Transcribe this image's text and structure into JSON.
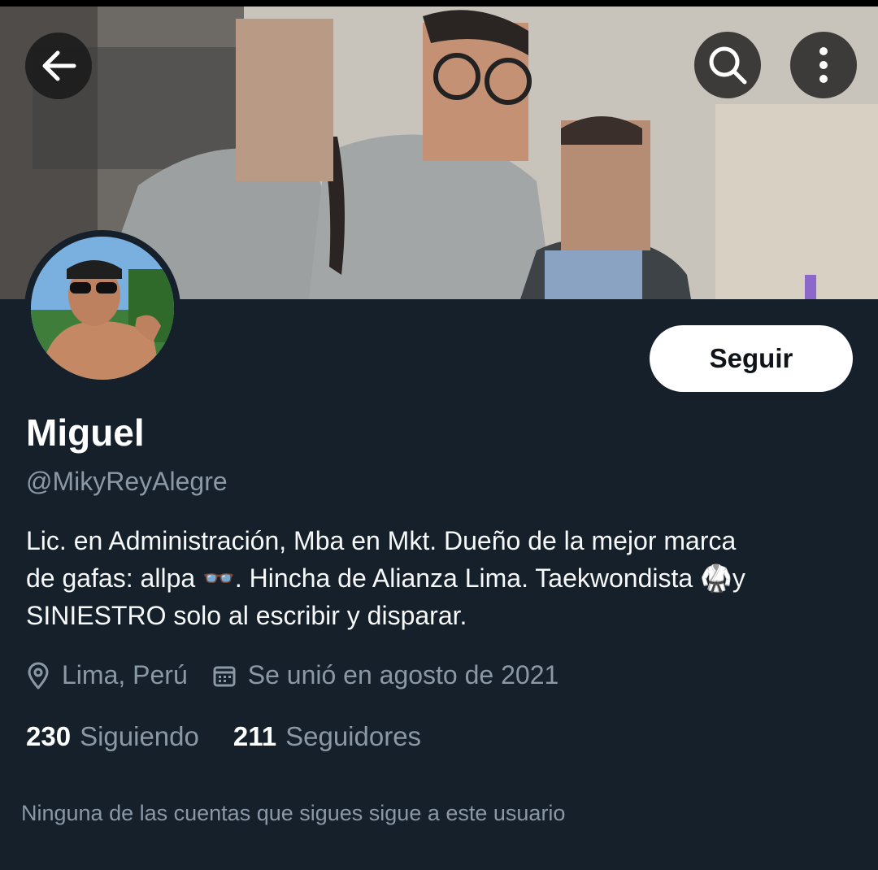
{
  "header": {
    "back_icon": "arrow-left-icon",
    "search_icon": "search-icon",
    "more_icon": "more-vertical-icon"
  },
  "profile": {
    "name": "Miguel",
    "handle": "@MikyReyAlegre",
    "follow_label": "Seguir",
    "bio_lines": [
      "Lic. en Administración, Mba en Mkt. Dueño de la mejor marca",
      "de gafas: allpa 👓. Hincha de Alianza Lima. Taekwondista 🥋y",
      "SINIESTRO solo al escribir y disparar."
    ],
    "location": "Lima, Perú",
    "joined": "Se unió en agosto de 2021",
    "following_count": "230",
    "following_label": "Siguiendo",
    "followers_count": "211",
    "followers_label": "Seguidores",
    "mutuals_note": "Ninguna de las cuentas que sigues sigue a este usuario"
  },
  "colors": {
    "background": "#15202b",
    "secondary_text": "#8b98a5",
    "follow_button": "#ffffff"
  }
}
